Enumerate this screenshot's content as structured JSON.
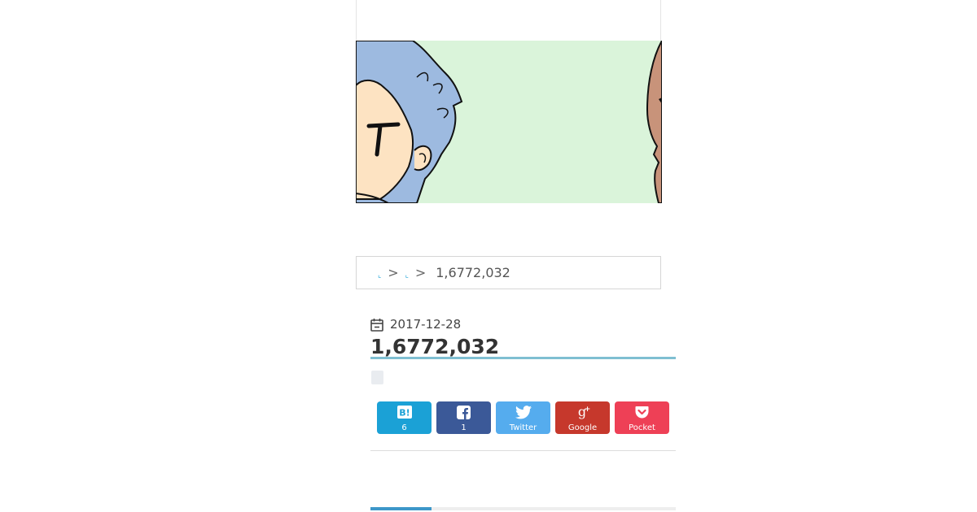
{
  "breadcrumb": {
    "home_link": "⌞",
    "separator": ">",
    "category_link": "⌞",
    "current": "1,6772,032"
  },
  "post": {
    "date": "2017-12-28",
    "title": "1,6772,032"
  },
  "share": {
    "hatena": {
      "icon": "hatena-bookmark-icon",
      "label": "6",
      "color": "#1ba1d6"
    },
    "facebook": {
      "icon": "facebook-icon",
      "label": "1",
      "color": "#3b5998"
    },
    "twitter": {
      "icon": "twitter-icon",
      "label": "Twitter",
      "color": "#55acee"
    },
    "google": {
      "icon": "google-plus-icon",
      "label": "Google",
      "color": "#c6382c"
    },
    "pocket": {
      "icon": "pocket-icon",
      "label": "Pocket",
      "color": "#ee4056"
    }
  },
  "colors": {
    "accent": "#3d97c9",
    "title_underline": "#7fbfd2",
    "image_background": "#daf4da"
  }
}
